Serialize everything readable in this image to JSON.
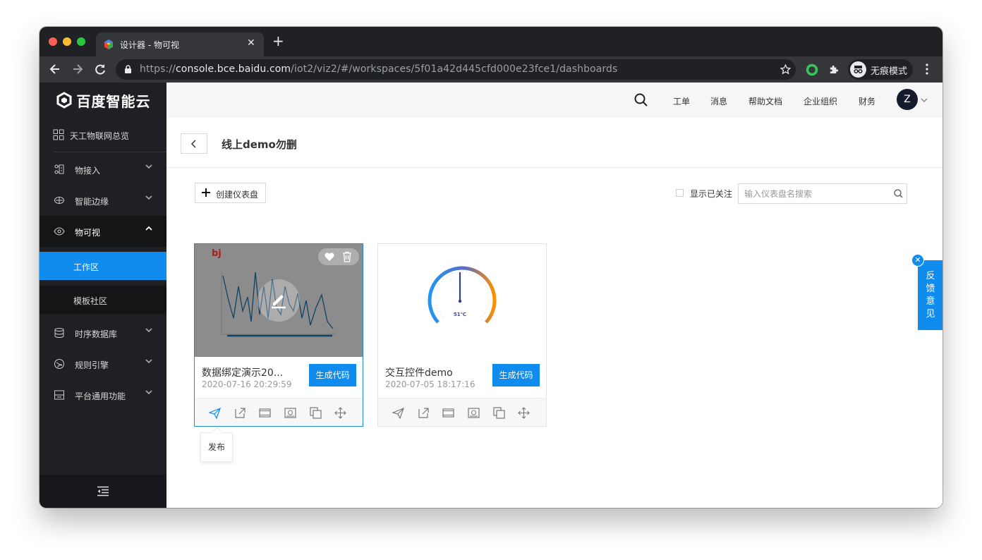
{
  "browser": {
    "tab_title": "设计器 - 物可视",
    "tab_close": "✕",
    "new_tab": "+",
    "url_scheme": "https://",
    "url_host": "console.bce.baidu.com",
    "url_path": "/iot2/viz2/#/workspaces/5f01a42d445cfd000e23fce1/dashboards",
    "incognito_label": "无痕模式",
    "traffic_lights": [
      "#ff5f57",
      "#febc2e",
      "#28c840"
    ]
  },
  "sidebar": {
    "logo_text": "百度智能云",
    "overview": "天工物联网总览",
    "items": [
      {
        "label": "物接入",
        "icon": "network-icon"
      },
      {
        "label": "智能边缘",
        "icon": "edge-icon"
      },
      {
        "label": "物可视",
        "icon": "eye-icon"
      }
    ],
    "sub_items": [
      "工作区",
      "模板社区"
    ],
    "items_after": [
      {
        "label": "时序数据库",
        "icon": "database-icon"
      },
      {
        "label": "规则引擎",
        "icon": "rule-icon"
      },
      {
        "label": "平台通用功能",
        "icon": "platform-icon"
      }
    ]
  },
  "header": {
    "links": [
      "工单",
      "消息",
      "帮助文档",
      "企业组织",
      "财务"
    ],
    "avatar_initial": "Z"
  },
  "page": {
    "title": "线上demo勿删",
    "create_button": "创建仪表盘",
    "follow_label": "显示已关注",
    "search_placeholder": "输入仪表盘名搜索"
  },
  "cards": [
    {
      "name": "数据绑定演示20...",
      "date": "2020-07-16 20:29:59",
      "button": "生成代码",
      "thumb_label": "bj"
    },
    {
      "name": "交互控件demo",
      "date": "2020-07-05 18:17:16",
      "button": "生成代码",
      "gauge_label": "51℃",
      "gauge_value": 51
    }
  ],
  "tooltip": "发布",
  "feedback": {
    "label": "反馈意见",
    "close": "✕"
  },
  "colors": {
    "accent": "#108cee",
    "sidebar": "#1f2024",
    "title_bar": "#202124"
  }
}
